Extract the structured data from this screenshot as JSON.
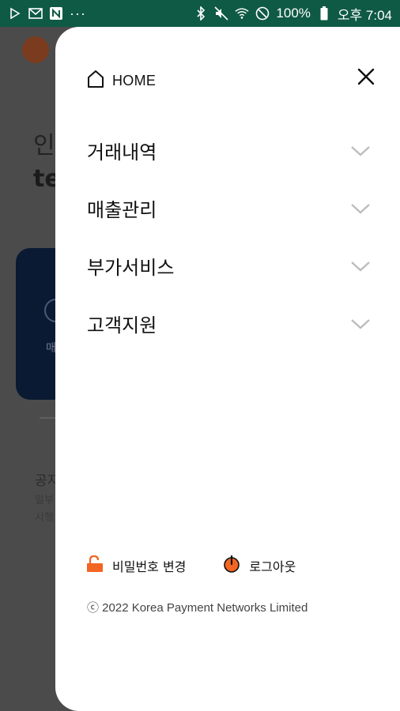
{
  "status_bar": {
    "battery": "100%",
    "time": "오후 7:04",
    "left_icons": [
      "play-store-icon",
      "gmail-icon",
      "naver-icon",
      "more-dots-icon"
    ],
    "right_icons": [
      "bluetooth-icon",
      "mute-icon",
      "wifi-icon",
      "do-not-disturb-icon",
      "battery-icon"
    ],
    "background": "#0f5a44"
  },
  "background_app": {
    "title_line1": "인",
    "title_line2": "te",
    "card_text": "매",
    "notice_title": "공지",
    "notice_line1": "일부",
    "notice_line2": "시행"
  },
  "drawer": {
    "home_label": "HOME",
    "menu_items": [
      {
        "label": "거래내역"
      },
      {
        "label": "매출관리"
      },
      {
        "label": "부가서비스"
      },
      {
        "label": "고객지원"
      }
    ],
    "change_password_label": "비밀번호 변경",
    "logout_label": "로그아웃",
    "copyright": "ⓒ 2022 Korea Payment Networks Limited",
    "accent_color": "#f26522"
  }
}
